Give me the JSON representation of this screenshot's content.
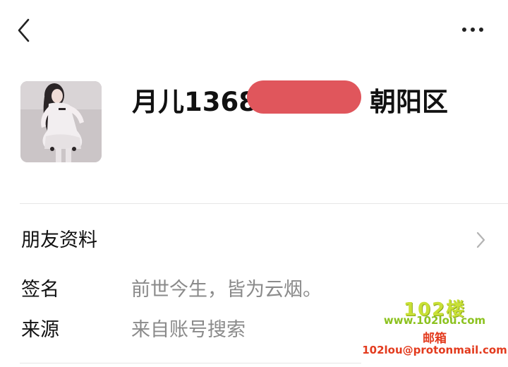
{
  "header": {
    "back_icon": "chevron-left-icon",
    "more_icon": "more-horizontal-icon"
  },
  "profile": {
    "name_prefix": "月儿1368",
    "name_suffix": "朝阳区",
    "name_redaction_color": "#e0565c",
    "avatar_icon": "profile-photo"
  },
  "friend_info": {
    "label": "朋友资料",
    "chevron_icon": "chevron-right-icon"
  },
  "details": [
    {
      "label": "签名",
      "value": "前世今生，皆为云烟。"
    },
    {
      "label": "来源",
      "value": "来自账号搜索"
    }
  ],
  "watermark": {
    "logo": "102楼",
    "site": "www.102lou.com",
    "mail_label": "邮箱",
    "email": "102lou@protonmail.com"
  }
}
